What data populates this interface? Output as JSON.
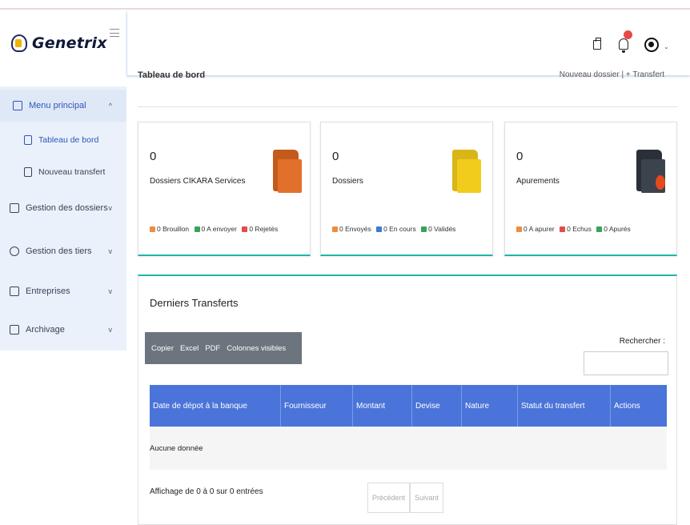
{
  "brand": {
    "name": "Genetrix"
  },
  "header": {
    "notification_badge": ""
  },
  "sidebar": {
    "items": [
      {
        "label": "Menu principal",
        "icon": "grid-icon",
        "caret": "^"
      },
      {
        "label": "Tableau de bord",
        "icon": "dashboard-icon"
      },
      {
        "label": "Nouveau transfert",
        "icon": "document-icon"
      },
      {
        "label": "Gestion des dossiers",
        "icon": "folder-icon",
        "caret": "v"
      },
      {
        "label": "Gestion des tiers",
        "icon": "people-icon",
        "caret": "v"
      },
      {
        "label": "Entreprises",
        "icon": "building-icon",
        "caret": "v"
      },
      {
        "label": "Archivage",
        "icon": "archive-icon",
        "caret": "v"
      }
    ]
  },
  "page": {
    "title": "Tableau de bord",
    "breadcrumb": "Nouveau dossier | + Transfert"
  },
  "stats": [
    {
      "value": "0",
      "title": "Dossiers CIKARA Services",
      "legend": [
        {
          "label": "0 Brouillon",
          "color": "#f08c3b"
        },
        {
          "label": "0 A envoyer",
          "color": "#3aa35a"
        },
        {
          "label": "0 Rejetés",
          "color": "#e64a4a"
        }
      ],
      "folder_color": "#e0702a"
    },
    {
      "value": "0",
      "title": "Dossiers",
      "legend": [
        {
          "label": "0 Envoyés",
          "color": "#f08c3b"
        },
        {
          "label": "0 En cours",
          "color": "#3a7bd5"
        },
        {
          "label": "0 Validés",
          "color": "#3aa35a"
        }
      ],
      "folder_color": "#f2cc1c"
    },
    {
      "value": "0",
      "title": "Apurements",
      "legend": [
        {
          "label": "0 A apurer",
          "color": "#f08c3b"
        },
        {
          "label": "0 Echus",
          "color": "#e64a4a"
        },
        {
          "label": "0 Apurés",
          "color": "#3aa35a"
        }
      ],
      "folder_color": "#3c434c"
    }
  ],
  "transfers": {
    "title": "Derniers Transferts",
    "export_buttons": [
      "Copier",
      "Excel",
      "PDF",
      "Colonnes visibles"
    ],
    "search_label": "Rechercher :",
    "search_value": "",
    "columns": [
      "Date de dépot à la banque",
      "Fournisseur",
      "Montant",
      "Devise",
      "Nature",
      "Statut du transfert",
      "Actions"
    ],
    "empty_text": "Aucune donnée",
    "info": "Affichage de 0 à 0 sur 0 entrées",
    "prev": "Précédent",
    "next": "Suivant"
  },
  "colors": {
    "accent": "#4a74d9",
    "teal": "#1eb7a6",
    "sidebar_bg": "#eaf1fb"
  }
}
